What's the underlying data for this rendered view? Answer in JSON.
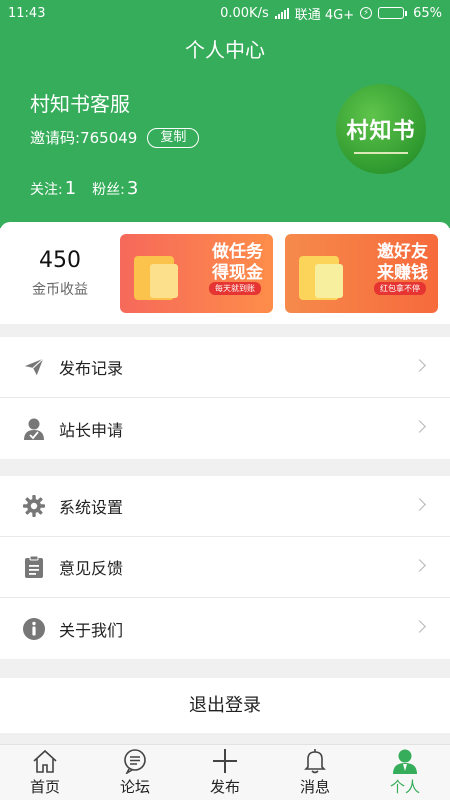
{
  "status": {
    "time": "11:43",
    "speed": "0.00K/s",
    "carrier": "联通 4G+",
    "battery": "65%",
    "battery_level": 0.65
  },
  "header": {
    "title": "个人中心",
    "username": "村知书客服",
    "invite_label": "邀请码: ",
    "invite_code": "765049",
    "copy_label": "复制",
    "follow_label": "关注:",
    "follow_count": "1",
    "fans_label": "粉丝:",
    "fans_count": "3",
    "logo_text": "村知书"
  },
  "coins": {
    "value": "450",
    "label": "金币收益"
  },
  "banners": [
    {
      "title_line1": "做任务",
      "title_line2": "得现金",
      "tagline": "每天就到账"
    },
    {
      "title_line1": "邀好友",
      "title_line2": "来赚钱",
      "tagline": "红包拿不停"
    }
  ],
  "menu_group1": [
    {
      "label": "发布记录",
      "icon": "paper-plane-icon"
    },
    {
      "label": "站长申请",
      "icon": "user-badge-icon"
    }
  ],
  "menu_group2": [
    {
      "label": "系统设置",
      "icon": "gear-icon"
    },
    {
      "label": "意见反馈",
      "icon": "clipboard-icon"
    },
    {
      "label": "关于我们",
      "icon": "info-icon"
    }
  ],
  "logout_label": "退出登录",
  "tabs": [
    {
      "label": "首页",
      "icon": "home-icon"
    },
    {
      "label": "论坛",
      "icon": "chat-icon"
    },
    {
      "label": "发布",
      "icon": "plus-icon"
    },
    {
      "label": "消息",
      "icon": "bell-icon"
    },
    {
      "label": "个人",
      "icon": "person-icon",
      "active": true
    }
  ],
  "colors": {
    "primary": "#36ad5a",
    "chevron": "#b5b5b5",
    "icon": "#777777"
  }
}
